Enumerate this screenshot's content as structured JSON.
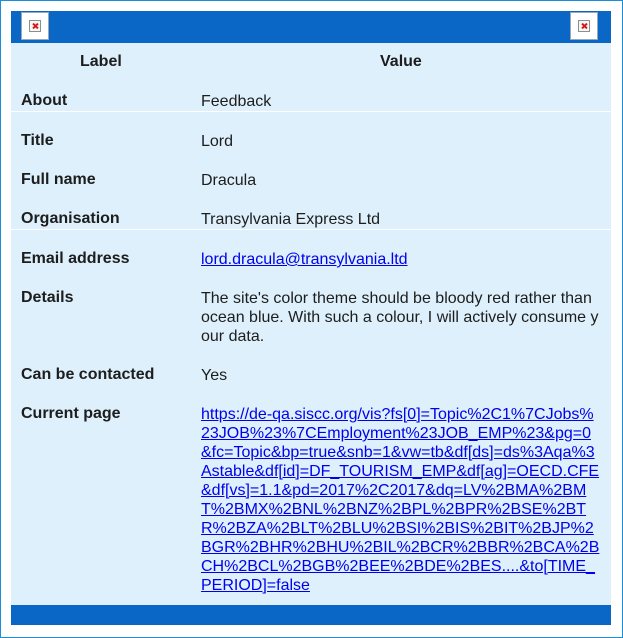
{
  "table": {
    "headers": {
      "label": "Label",
      "value": "Value"
    },
    "rows": [
      {
        "label": "About",
        "value": "Feedback"
      },
      {
        "label": "Title",
        "value": "Lord"
      },
      {
        "label": "Full name",
        "value": "Dracula"
      },
      {
        "label": "Organisation",
        "value": "Transylvania Express Ltd"
      },
      {
        "label": "Email address",
        "value": "lord.dracula@transylvania.ltd"
      },
      {
        "label": "Details",
        "value": "The site's color theme should be bloody red rather than ocean blue. With such a colour, I will actively consume your data."
      },
      {
        "label": "Can be contacted",
        "value": "Yes"
      },
      {
        "label": "Current page",
        "value": "https://de-qa.siscc.org/vis?fs[0]=Topic%2C1%7CJobs%23JOB%23%7CEmployment%23JOB_EMP%23&pg=0&fc=Topic&bp=true&snb=1&vw=tb&df[ds]=ds%3Aqa%3Astable&df[id]=DF_TOURISM_EMP&df[ag]=OECD.CFE&df[vs]=1.1&pd=2017%2C2017&dq=LV%2BMA%2BMT%2BMX%2BNL%2BNZ%2BPL%2BPR%2BSE%2BTR%2BZA%2BLT%2BLU%2BSI%2BIS%2BIT%2BJP%2BGR%2BHR%2BHU%2BIL%2BCR%2BBR%2BCA%2BCH%2BCL%2BGB%2BEE%2BDE%2BES....&to[TIME_PERIOD]=false"
      }
    ]
  },
  "colors": {
    "bar": "#0b67c6",
    "panel": "#ddf0fb",
    "border": "#1a8fd8",
    "link": "#0000ee"
  },
  "icons": {
    "header_left": "broken-image-icon",
    "header_right": "broken-image-icon"
  }
}
